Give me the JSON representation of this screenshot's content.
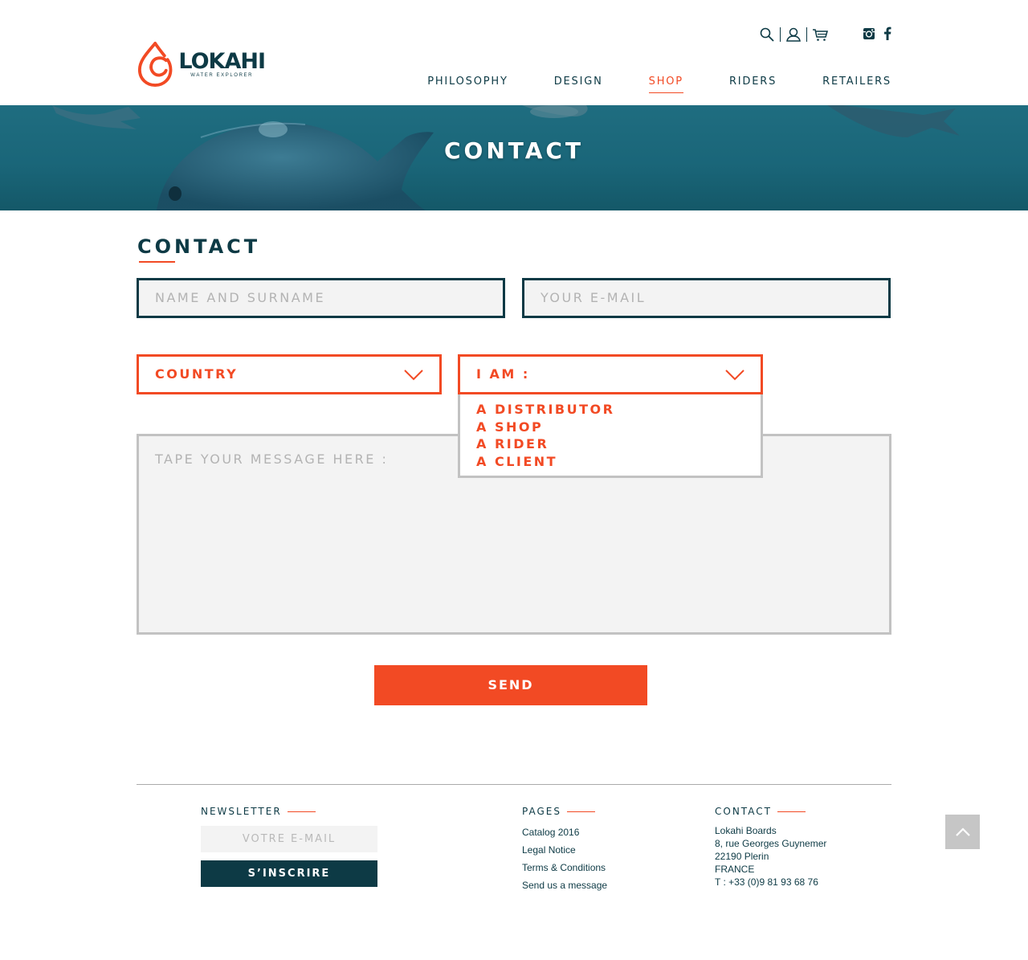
{
  "brand": {
    "name": "LOKAHI",
    "tagline": "WATER EXPLORER",
    "accent_color": "#f24a24",
    "dark_color": "#0d3a45"
  },
  "header": {
    "utility_icons": [
      "search-icon",
      "user-icon",
      "cart-icon"
    ],
    "social_icons": [
      "instagram-icon",
      "facebook-icon"
    ],
    "nav": [
      {
        "label": "PHILOSOPHY",
        "active": false
      },
      {
        "label": "DESIGN",
        "active": false
      },
      {
        "label": "SHOP",
        "active": true
      },
      {
        "label": "RIDERS",
        "active": false
      },
      {
        "label": "RETAILERS",
        "active": false
      }
    ]
  },
  "hero": {
    "title": "CONTACT"
  },
  "contact_form": {
    "section_title": "CONTACT",
    "name_placeholder": "NAME AND SURNAME",
    "email_placeholder": "YOUR E-MAIL",
    "country_select": "COUNTRY",
    "iam_select": "I AM :",
    "iam_options": [
      "A DISTRIBUTOR",
      "A SHOP",
      "A RIDER",
      "A CLIENT"
    ],
    "message_placeholder": "TAPE YOUR MESSAGE HERE :",
    "send_label": "SEND"
  },
  "footer": {
    "newsletter": {
      "title": "NEWSLETTER",
      "input_placeholder": "VOTRE E-MAIL",
      "button_label": "S’INSCRIRE"
    },
    "pages": {
      "title": "PAGES",
      "links": [
        "Catalog 2016",
        "Legal Notice",
        "Terms & Conditions",
        "Send us a message"
      ]
    },
    "contact": {
      "title": "CONTACT",
      "lines": [
        "Lokahi Boards",
        "8, rue Georges Guynemer",
        "22190 Plerin",
        "FRANCE",
        "T : +33 (0)9 81 93 68 76"
      ]
    },
    "back_to_top_icon": "chevron-up-icon"
  }
}
